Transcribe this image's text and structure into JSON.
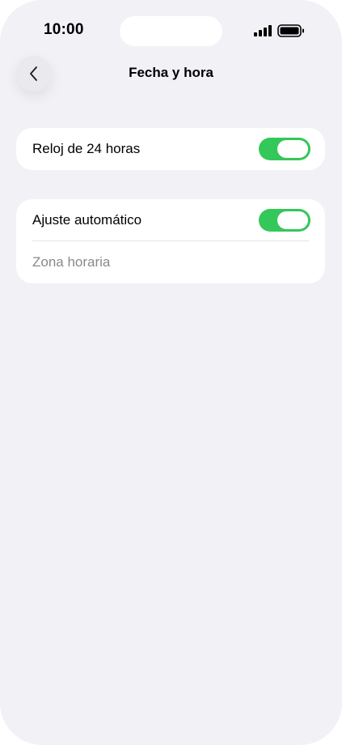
{
  "status_bar": {
    "time": "10:00"
  },
  "header": {
    "title": "Fecha y hora",
    "back_icon": "chevron-left-icon"
  },
  "settings": {
    "clock_24h": {
      "label": "Reloj de 24 horas",
      "enabled": true
    },
    "auto_adjust": {
      "label": "Ajuste automático",
      "enabled": true
    },
    "time_zone": {
      "label": "Zona horaria"
    }
  },
  "colors": {
    "background": "#f1f1f6",
    "card": "#ffffff",
    "toggle_on": "#34c759",
    "muted_text": "#8a8a8e"
  }
}
